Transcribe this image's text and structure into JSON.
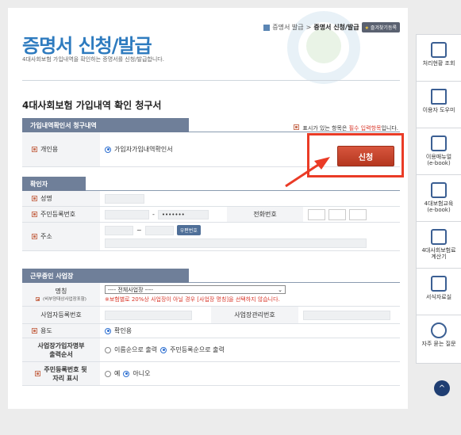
{
  "breadcrumb": {
    "parent": "증명서 발급",
    "sep": ">",
    "current": "증명서 신청/발급",
    "favorite": "즐겨찾기등록"
  },
  "header": {
    "title": "증명서 신청/발급",
    "subtitle": "4대사회보험 가입내역을 확인하는 증명서를 신청/발급합니다."
  },
  "form_title": "4대사회보험 가입내역 확인 청구서",
  "required_note": {
    "prefix": "표시가 있는 항목은 ",
    "required": "필수 입력항목",
    "suffix": "입니다."
  },
  "section1": {
    "tab": "가입내역확인서 청구내역",
    "usage_label": "개인용",
    "usage_option": "가입자가입내역확인서",
    "apply_button": "신청"
  },
  "section2": {
    "tab": "확인자",
    "name_label": "성명",
    "rrn_label": "주민등록번호",
    "rrn_masked": "•••••••",
    "rrn_sep": "-",
    "phone_label": "전화번호",
    "address_label": "주소",
    "postal_sep": "~",
    "postal_button": "우편번호"
  },
  "section3": {
    "tab": "근무중인 사업장",
    "company_label": "명칭",
    "company_sublabel": "(비부양대상사업장포함)",
    "company_select": "---- 전체사업장 ----",
    "company_warning": "※보험별로 20%상 사업장이 아닐 경우 [사업장 명칭]을 선택하지 않습니다.",
    "bizno_label": "사업자등록번호",
    "mgmtno_label": "사업장관리번호",
    "purpose_label": "용도",
    "purpose_option": "확인용",
    "order_label": "사업장가입자명부\n출력순서",
    "order_opt1": "이름순으로 출력",
    "order_opt2": "주민등록순으로 출력",
    "rrnback_label": "주민등록번호 뒷\n자리 표시",
    "rrnback_opt1": "예",
    "rrnback_opt2": "아니오"
  },
  "sidebar": {
    "items": [
      {
        "label": "처리현황 조회",
        "icon": "document-search-icon"
      },
      {
        "label": "이용자 도우미",
        "icon": "laptop-help-icon"
      },
      {
        "label": "이용매뉴얼\n(e-book)",
        "icon": "manual-edit-icon"
      },
      {
        "label": "4대보험교육\n(e-book)",
        "icon": "open-book-icon"
      },
      {
        "label": "4대사회보험료\n계산기",
        "icon": "calculator-icon"
      },
      {
        "label": "서식자료실",
        "icon": "forms-list-icon"
      },
      {
        "label": "자주 묻는 질문",
        "icon": "chat-question-icon"
      }
    ],
    "top_button": "^"
  },
  "colors": {
    "accent": "#2e7bbf",
    "tab": "#6f7f99",
    "highlight": "#ea3b26",
    "button": "#c0452a"
  }
}
